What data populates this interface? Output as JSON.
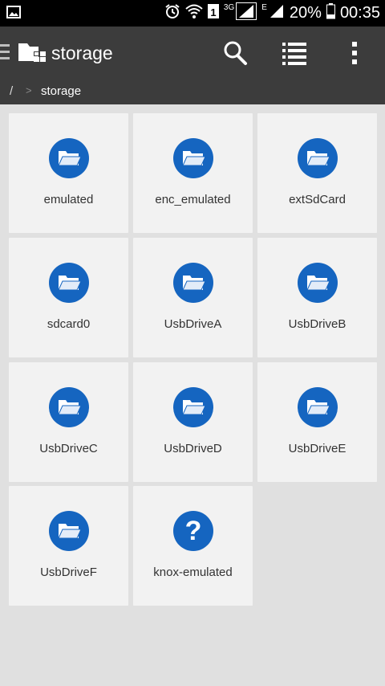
{
  "status_bar": {
    "signal_badge": "3G",
    "data_badge": "E",
    "battery_percent": "20%",
    "time": "00:35"
  },
  "toolbar": {
    "title": "storage"
  },
  "breadcrumb": {
    "root": "/",
    "separator": ">",
    "current": "storage"
  },
  "items": [
    {
      "label": "emulated",
      "icon": "folder-icon"
    },
    {
      "label": "enc_emulated",
      "icon": "folder-icon"
    },
    {
      "label": "extSdCard",
      "icon": "folder-icon"
    },
    {
      "label": "sdcard0",
      "icon": "folder-icon"
    },
    {
      "label": "UsbDriveA",
      "icon": "folder-icon"
    },
    {
      "label": "UsbDriveB",
      "icon": "folder-icon"
    },
    {
      "label": "UsbDriveC",
      "icon": "folder-icon"
    },
    {
      "label": "UsbDriveD",
      "icon": "folder-icon"
    },
    {
      "label": "UsbDriveE",
      "icon": "folder-icon"
    },
    {
      "label": "UsbDriveF",
      "icon": "folder-icon"
    },
    {
      "label": "knox-emulated",
      "icon": "question-icon",
      "icon_glyph": "?"
    }
  ],
  "colors": {
    "toolbar": "#3c3c3c",
    "icon_circle": "#1565c0",
    "tile": "#f2f2f2",
    "background": "#e0e0e0"
  }
}
